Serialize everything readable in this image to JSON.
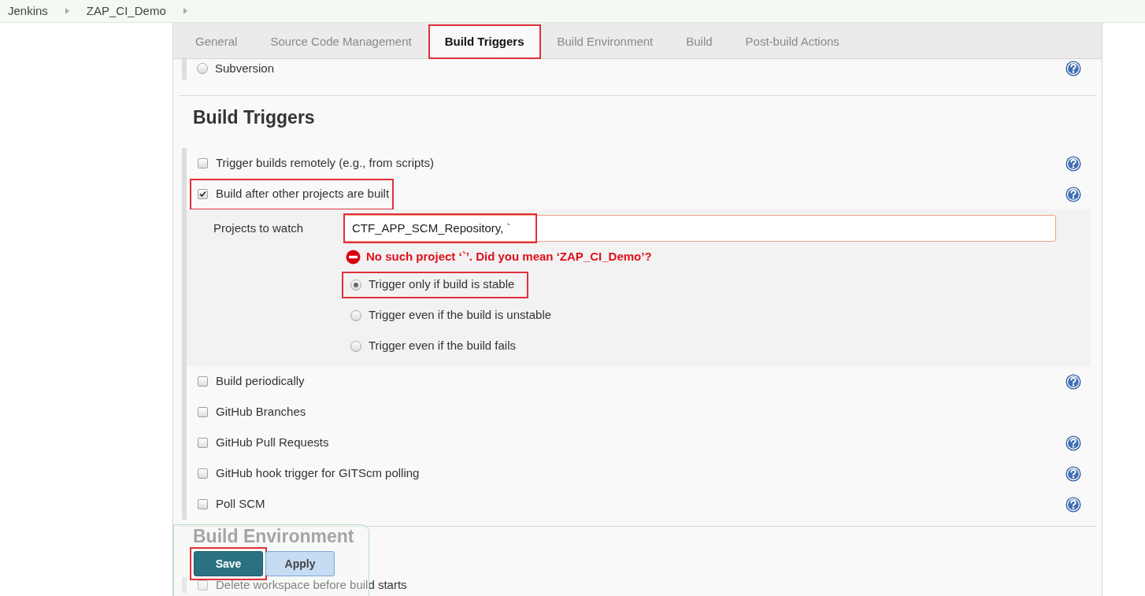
{
  "breadcrumbs": [
    "Jenkins",
    "ZAP_CI_Demo"
  ],
  "tabs": [
    {
      "label": "General",
      "selected": false,
      "highlighted": false
    },
    {
      "label": "Source Code Management",
      "selected": false,
      "highlighted": false
    },
    {
      "label": "Build Triggers",
      "selected": true,
      "highlighted": true
    },
    {
      "label": "Build Environment",
      "selected": false,
      "highlighted": false
    },
    {
      "label": "Build",
      "selected": false,
      "highlighted": false
    },
    {
      "label": "Post-build Actions",
      "selected": false,
      "highlighted": false
    }
  ],
  "scm_option": {
    "label": "Subversion",
    "selected": false,
    "help": true
  },
  "build_triggers": {
    "title": "Build Triggers",
    "options": [
      {
        "label": "Trigger builds remotely (e.g., from scripts)",
        "checked": false,
        "help": true,
        "highlighted": false
      },
      {
        "label": "Build after other projects are built",
        "checked": true,
        "help": true,
        "highlighted": true,
        "details": {
          "field_label": "Projects to watch",
          "value": "CTF_APP_SCM_Repository, `",
          "highlighted": true,
          "error": "No such project ‘`’. Did you mean ‘ZAP_CI_Demo’?",
          "radios": [
            {
              "label": "Trigger only if build is stable",
              "selected": true,
              "highlighted": true
            },
            {
              "label": "Trigger even if the build is unstable",
              "selected": false,
              "highlighted": false
            },
            {
              "label": "Trigger even if the build fails",
              "selected": false,
              "highlighted": false
            }
          ]
        }
      },
      {
        "label": "Build periodically",
        "checked": false,
        "help": true,
        "highlighted": false
      },
      {
        "label": "GitHub Branches",
        "checked": false,
        "help": false,
        "highlighted": false
      },
      {
        "label": "GitHub Pull Requests",
        "checked": false,
        "help": true,
        "highlighted": false
      },
      {
        "label": "GitHub hook trigger for GITScm polling",
        "checked": false,
        "help": true,
        "highlighted": false
      },
      {
        "label": "Poll SCM",
        "checked": false,
        "help": true,
        "highlighted": false
      }
    ]
  },
  "build_environment": {
    "title": "Build Environment",
    "options": [
      {
        "label": "Delete workspace before build starts",
        "checked": false
      }
    ]
  },
  "buttons": [
    {
      "kind": "primary",
      "label": "Save",
      "highlighted": true
    },
    {
      "kind": "secondary",
      "label": "Apply",
      "highlighted": false
    }
  ]
}
